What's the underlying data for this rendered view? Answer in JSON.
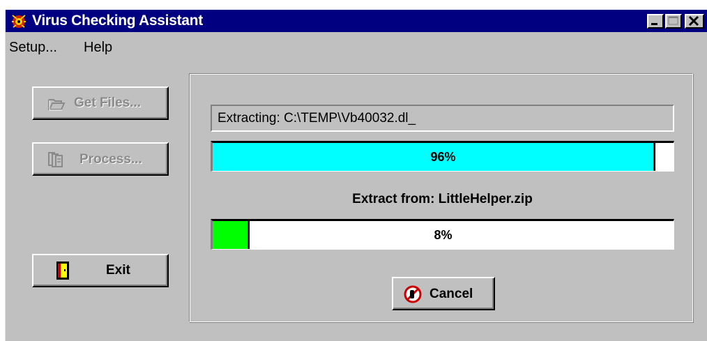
{
  "window": {
    "title": "Virus Checking Assistant"
  },
  "menu": [
    {
      "label": "Setup..."
    },
    {
      "label": "Help"
    }
  ],
  "buttons": {
    "get_files": "Get Files...",
    "process": "Process...",
    "exit": "Exit",
    "cancel": "Cancel"
  },
  "status": {
    "extracting": "Extracting: C:\\TEMP\\Vb40032.dl_"
  },
  "progress_overall": {
    "value": 0.96,
    "label": "96%",
    "color": "#00ffff"
  },
  "extract_from": "Extract from: LittleHelper.zip",
  "progress_file": {
    "value": 0.08,
    "label": "8%",
    "color": "#00ff00"
  },
  "icons": [
    "app-icon",
    "minimize-icon",
    "maximize-icon",
    "close-icon",
    "folder-open-icon",
    "documents-icon",
    "door-exit-icon",
    "stop-icon"
  ]
}
